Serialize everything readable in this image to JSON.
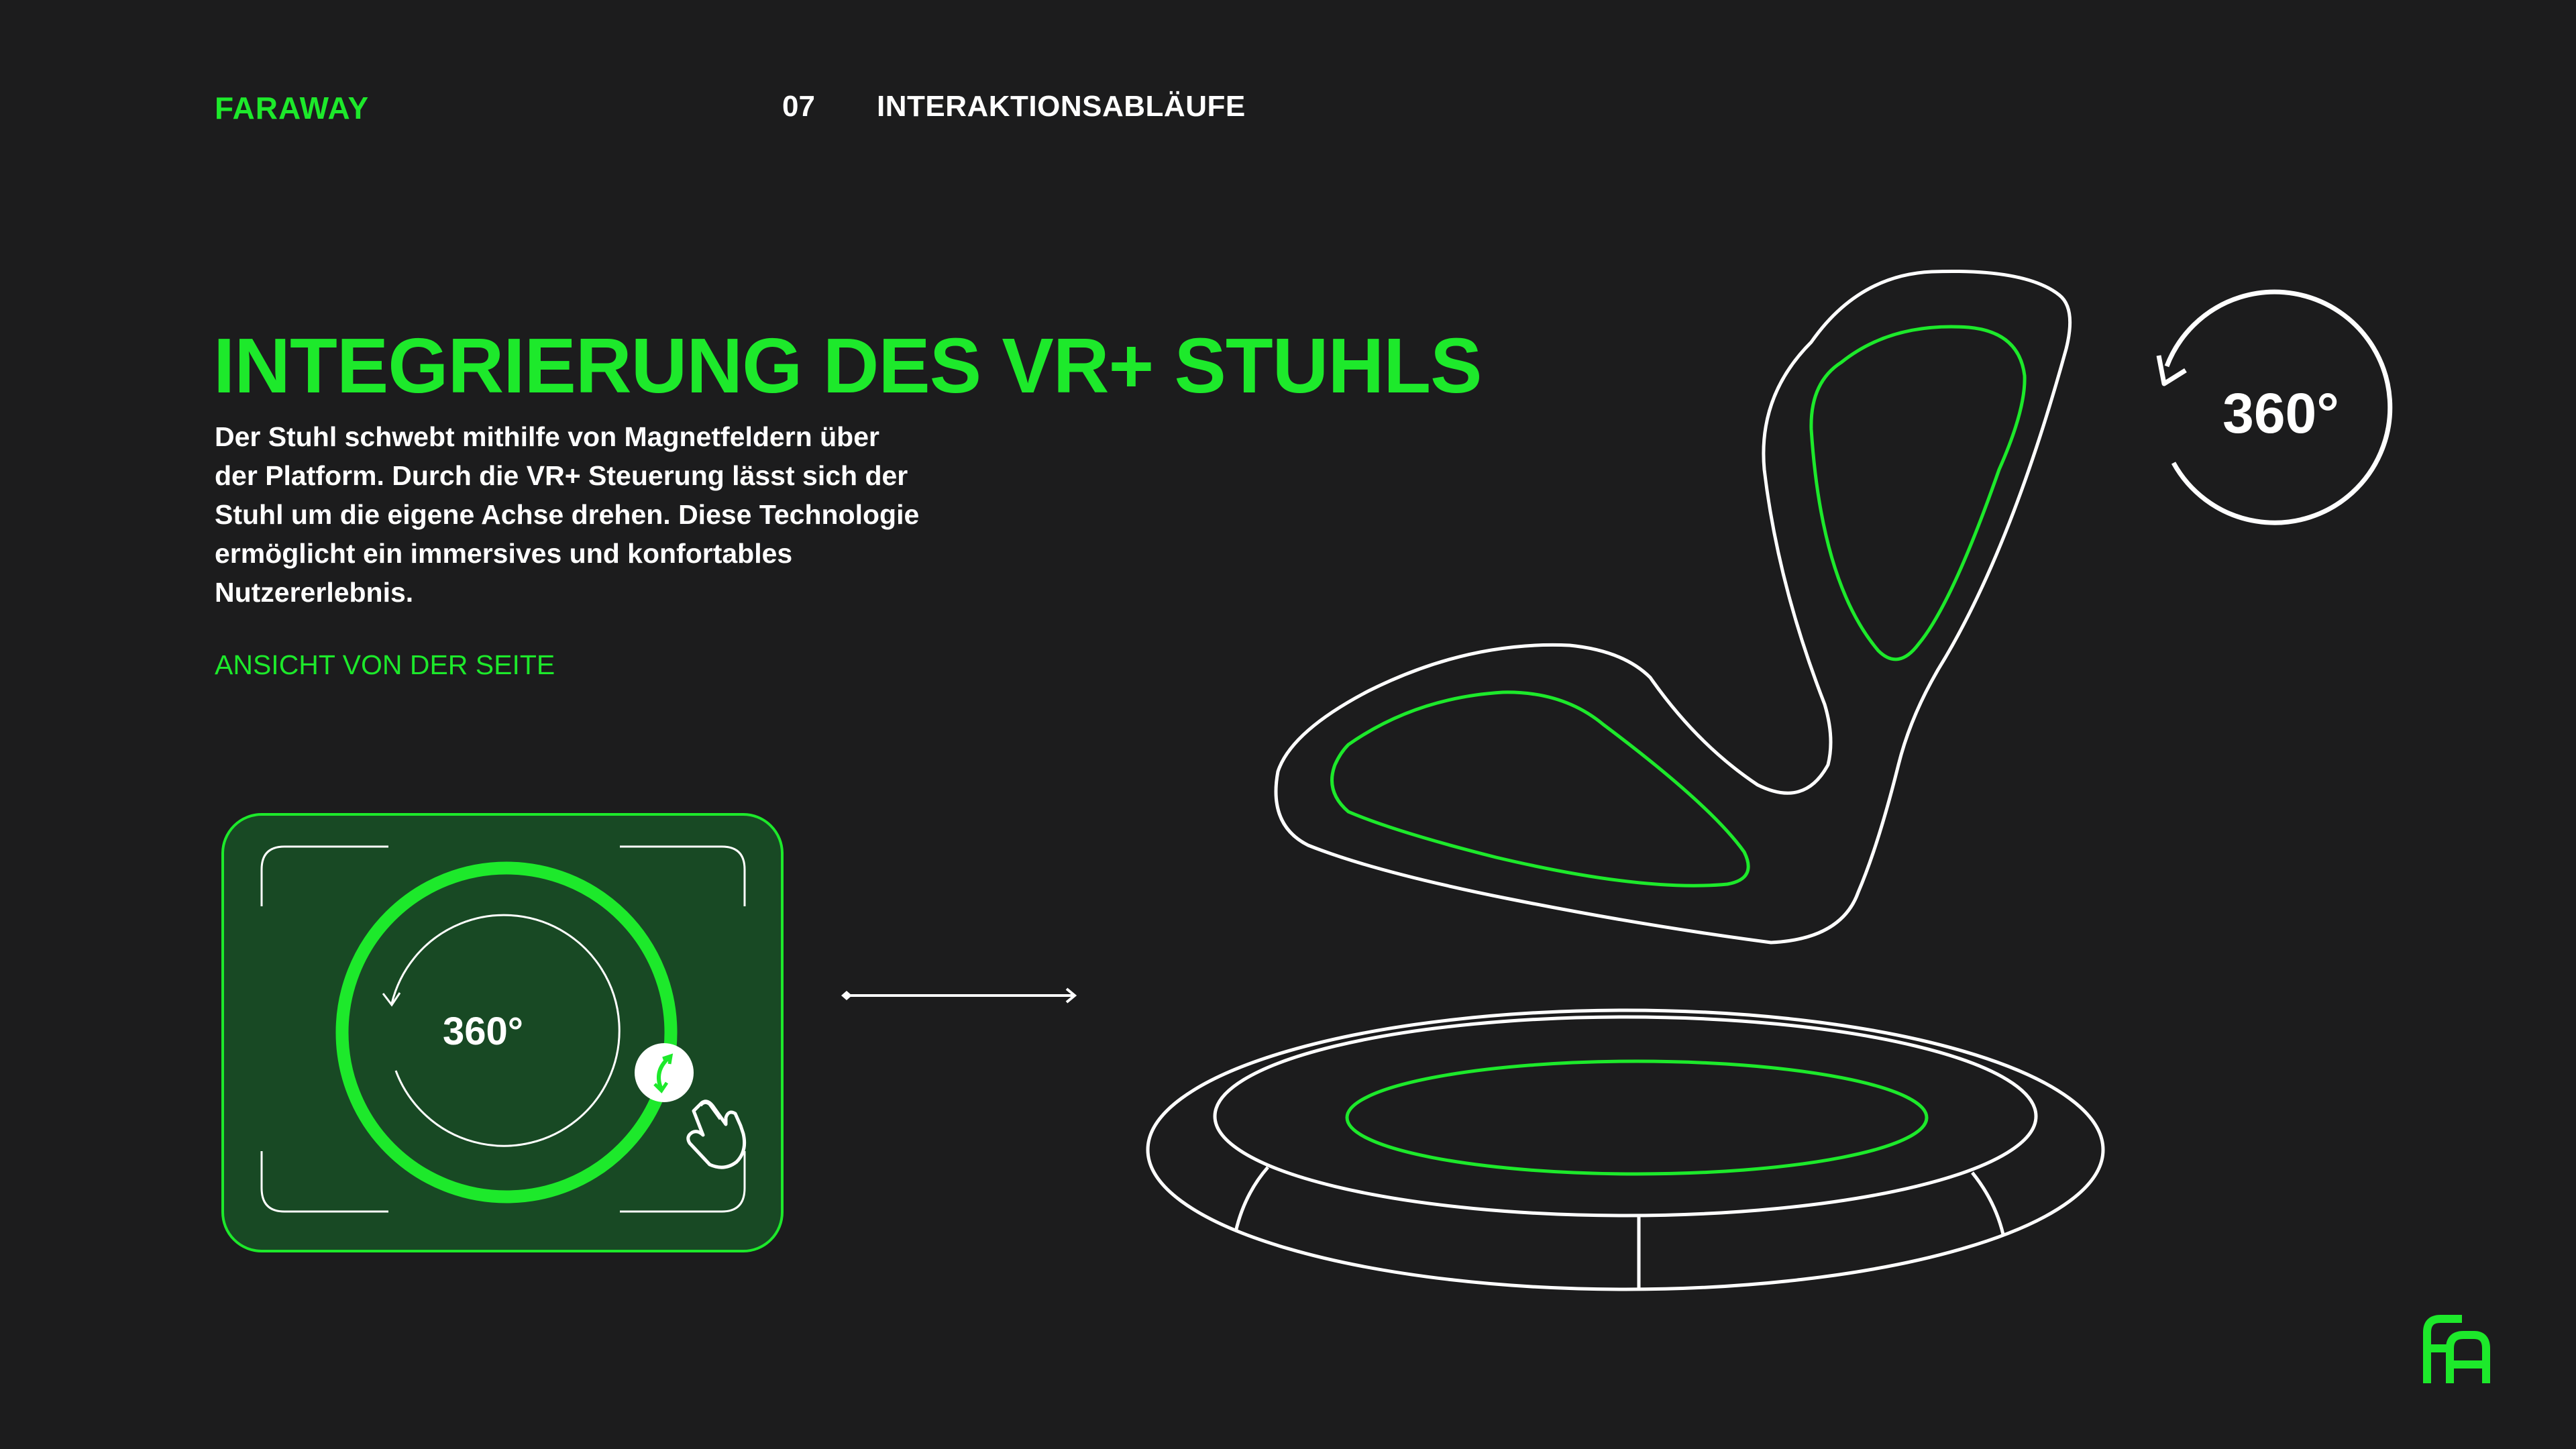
{
  "header": {
    "brand": "FARAWAY",
    "section_number": "07",
    "section_title": "INTERAKTIONSABLÄUFE"
  },
  "main": {
    "headline": "INTEGRIERUNG DES VR+ STUHLS",
    "body": "Der Stuhl schwebt mithilfe von Magnetfeldern über der Platform. Durch die VR+ Steuerung lässt sich der Stuhl um die eigene Achse drehen. Diese Technologie ermöglicht ein immersives und konfortables Nutzererlebnis.",
    "view_label": "ANSICHT VON DER SEITE"
  },
  "control": {
    "rotation_label": "360°"
  },
  "illustration": {
    "rotation_label": "360°"
  },
  "colors": {
    "accent": "#1de92b",
    "background": "#1c1c1d",
    "card_fill": "#184924",
    "text": "#ffffff"
  },
  "icons": [
    "rotate-arrow-icon",
    "hand-pointer-icon",
    "faraway-logo-icon"
  ]
}
